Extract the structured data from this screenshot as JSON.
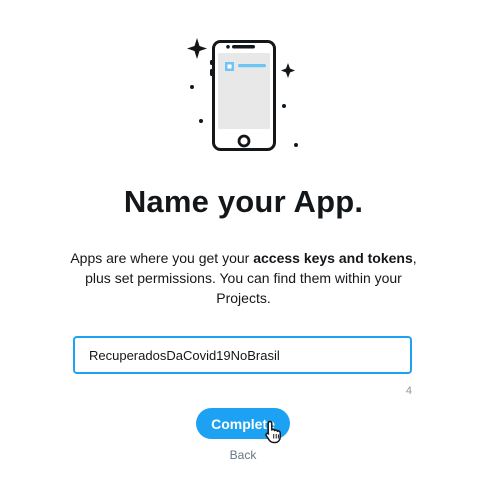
{
  "page": {
    "title": "Name your App.",
    "description": {
      "part1": "Apps are where you get your ",
      "bold": "access keys and tokens",
      "part2": ", plus set permissions. You can find them within your Projects."
    }
  },
  "form": {
    "app_name_value": "RecuperadosDaCovid19NoBrasil",
    "char_count": "4"
  },
  "actions": {
    "complete_label": "Complete",
    "back_label": "Back"
  },
  "icons": {
    "illustration": "phone-app-icon",
    "cursor": "hand-pointer-icon"
  },
  "colors": {
    "accent": "#1da1f2",
    "text": "#14171a",
    "muted": "#657786",
    "counter": "#8e979e"
  }
}
